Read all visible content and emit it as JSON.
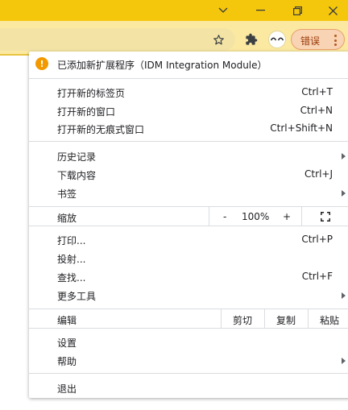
{
  "window": {
    "controls": [
      "chevron-down",
      "minimize",
      "restore",
      "close"
    ]
  },
  "toolbar": {
    "error_label": "错误",
    "icons": [
      "star",
      "extensions",
      "profile-avatar",
      "more"
    ]
  },
  "menu": {
    "notice": "已添加新扩展程序（IDM Integration Module）",
    "group1": [
      {
        "label": "打开新的标签页",
        "shortcut": "Ctrl+T"
      },
      {
        "label": "打开新的窗口",
        "shortcut": "Ctrl+N"
      },
      {
        "label": "打开新的无痕式窗口",
        "shortcut": "Ctrl+Shift+N"
      }
    ],
    "group2": [
      {
        "label": "历史记录",
        "shortcut": "",
        "submenu": true
      },
      {
        "label": "下载内容",
        "shortcut": "Ctrl+J"
      },
      {
        "label": "书签",
        "shortcut": "",
        "submenu": true
      }
    ],
    "zoom": {
      "label": "缩放",
      "minus": "-",
      "value": "100%",
      "plus": "+"
    },
    "group3": [
      {
        "label": "打印...",
        "shortcut": "Ctrl+P"
      },
      {
        "label": "投射...",
        "shortcut": ""
      },
      {
        "label": "查找...",
        "shortcut": "Ctrl+F"
      },
      {
        "label": "更多工具",
        "shortcut": "",
        "submenu": true
      }
    ],
    "edit": {
      "label": "编辑",
      "cut": "剪切",
      "copy": "复制",
      "paste": "粘贴"
    },
    "group4": [
      {
        "label": "设置",
        "shortcut": ""
      },
      {
        "label": "帮助",
        "shortcut": "",
        "submenu": true
      }
    ],
    "exit": "退出"
  },
  "colors": {
    "titlebar": "#f4c70c",
    "toolbar": "#fbe9a1",
    "warning": "#f29900",
    "error_chip": "#f8d3b4"
  }
}
